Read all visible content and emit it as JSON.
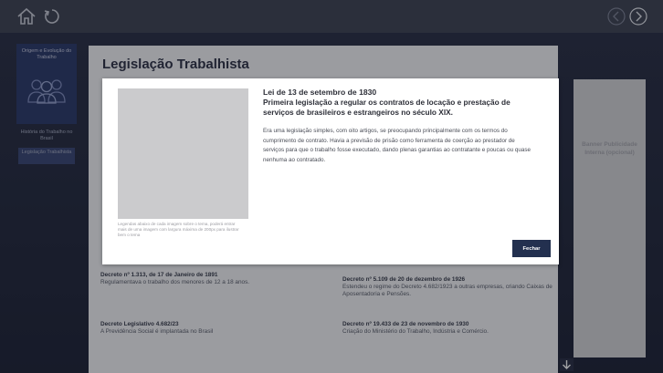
{
  "topbar": {
    "icons": {
      "home": "home-icon",
      "refresh": "refresh-icon",
      "prev": "chevron-left-icon",
      "next": "chevron-right-icon"
    }
  },
  "sidebar": {
    "header_label": "Origem e Evolução do Trabalho",
    "items": [
      {
        "label": "História do Trabalho no Brasil"
      },
      {
        "label": "Legislação Trabalhista"
      }
    ]
  },
  "main": {
    "title": "Legislação Trabalhista",
    "entries": [
      {
        "title": "Decreto nº 1.313, de 17 de Janeiro de 1891",
        "text": "Regulamentava o trabalho dos menores de 12 a 18 anos."
      },
      {
        "title": "Decreto nº 5.109 de 20 de dezembro de 1926",
        "text": "Estendeu o regime do Decreto 4.682/1923 a outras empresas, criando Caixas de Aposentadoria e Pensões."
      },
      {
        "title": "Decreto Legislativo 4.682/23",
        "text": "A Previdência Social é implantada no Brasil"
      },
      {
        "title": "Decreto nº 19.433 de 23 de novembro de 1930",
        "text": "Criação do Ministério do Trabalho, Indústria e Comércio."
      }
    ]
  },
  "banner": {
    "label": "Banner Publicidade Interna (opcional)"
  },
  "modal": {
    "date": "Lei de 13 de setembro de 1830",
    "subtitle": "Primeira legislação a regular os contratos de locação e prestação de serviços de brasileiros e estrangeiros no século XIX.",
    "body": "Era uma legislação simples, com oito artigos, se preocupando principalmente com os termos do cumprimento de contrato. Havia a previsão de prisão como ferramenta de coerção ao prestador de serviços para que o trabalho fosse executado, dando plenas garantias ao contratante e poucas ou quase nenhuma ao contratado.",
    "image_caption": "Legendas abaixo de cada imagem sobre o tema, poderá entrar mais de uma imagem com largura máxima de 200px para ilustrar bem o tema",
    "close_label": "Fechar"
  },
  "colors": {
    "topbar": "#3f4453",
    "accent": "#2d3a6a",
    "button": "#23304f"
  }
}
